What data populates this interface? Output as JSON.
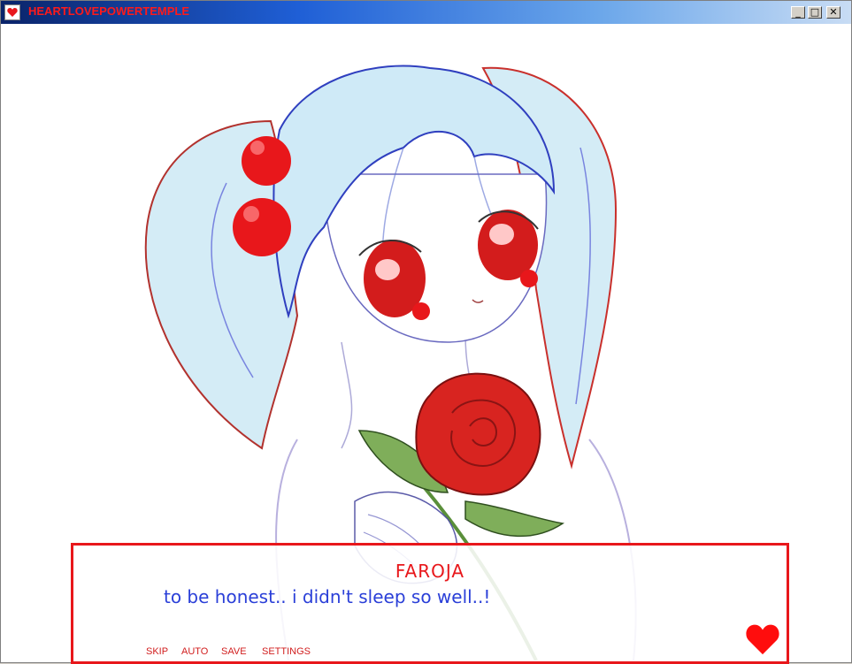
{
  "window": {
    "title": "HEARTLOVEPOWERTEMPLE",
    "controls": {
      "minimize": "_",
      "maximize": "□",
      "close": "✕"
    }
  },
  "scene": {
    "character_image": "anime girl with light blue twin tails, red hair ornaments and red eyes, holding a red rose"
  },
  "dialog": {
    "speaker": "FAROJA",
    "text": "to be honest.. i didn't sleep so well..!",
    "menu": [
      "SKIP",
      "AUTO",
      "SAVE",
      "SETTINGS"
    ],
    "advance_icon": "heart-icon"
  },
  "colors": {
    "accent_red": "#e8171b",
    "text_blue": "#2a3fd8",
    "hair": "#cfeaf7"
  }
}
